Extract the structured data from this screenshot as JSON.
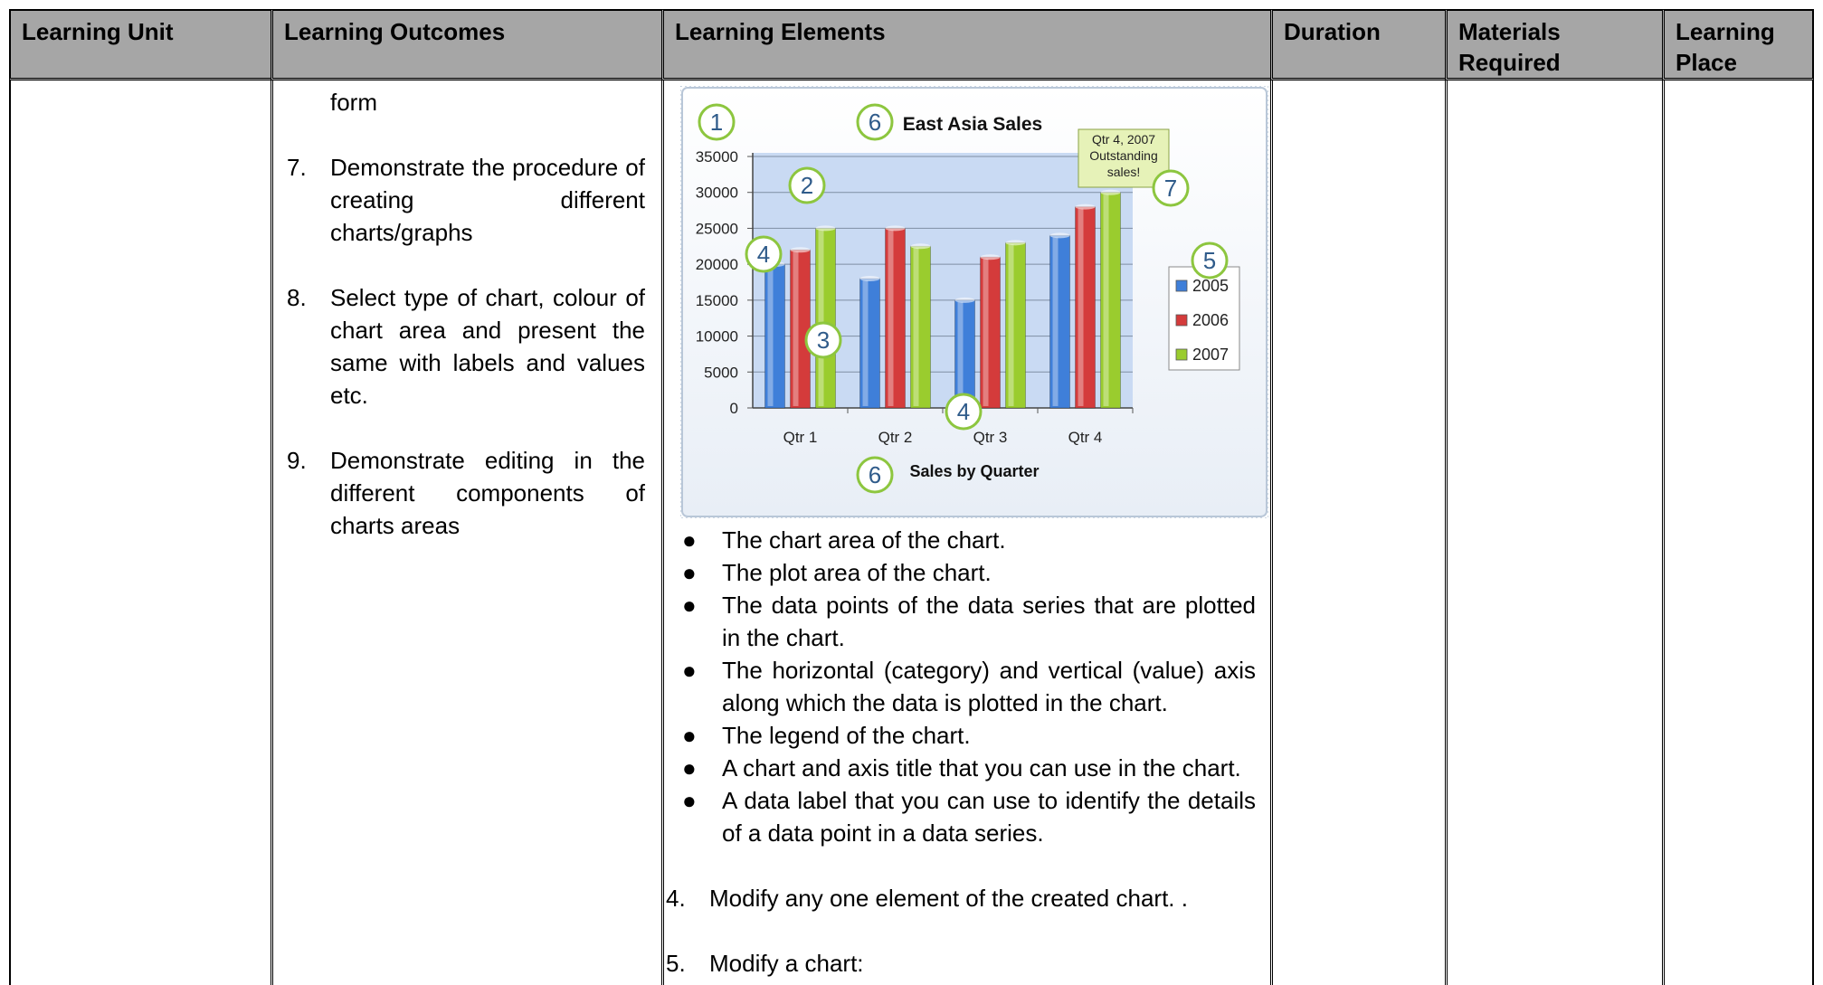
{
  "table": {
    "headers": [
      "Learning Unit",
      "Learning Outcomes",
      "Learning Elements",
      "Duration",
      "Materials Required",
      "Learning Place"
    ]
  },
  "outcomes": {
    "continued_text": "form",
    "items": [
      {
        "num": "7.",
        "text": "Demonstrate the procedure of creating different charts/graphs"
      },
      {
        "num": "8.",
        "text": "Select type of chart, colour of chart area and   present the same with labels and values etc."
      },
      {
        "num": "9.",
        "text": "Demonstrate editing in the different components of charts areas"
      }
    ]
  },
  "elements": {
    "bullets": [
      "The chart area of the chart.",
      "The plot area of the chart.",
      "The data points of the data series that are plotted in the chart.",
      "The horizontal (category) and vertical (value) axis along which the data is plotted in the chart.",
      "The legend of the chart.",
      "A chart and axis title that you can use in the chart.",
      "A data label that you can use to identify the details of a data point in a data series."
    ],
    "numbered": [
      {
        "num": "4.",
        "text": "Modify any one element of the created chart. ."
      },
      {
        "num": "5.",
        "text": "Modify a chart:"
      }
    ]
  },
  "chart_data": {
    "type": "bar",
    "title": "East Asia Sales",
    "xlabel": "Sales by Quarter",
    "ylabel": "",
    "categories": [
      "Qtr 1",
      "Qtr 2",
      "Qtr 3",
      "Qtr 4"
    ],
    "ylim": [
      0,
      35000
    ],
    "yticks": [
      "35000",
      "30000",
      "25000",
      "20000",
      "15000",
      "10000",
      "5000",
      "0"
    ],
    "series": [
      {
        "name": "2005",
        "values": [
          20000,
          18000,
          15000,
          24000
        ],
        "color": "#3f7fd9"
      },
      {
        "name": "2006",
        "values": [
          22000,
          25000,
          21000,
          28000
        ],
        "color": "#d43b3b"
      },
      {
        "name": "2007",
        "values": [
          25000,
          22500,
          23000,
          30000
        ],
        "color": "#9acc2e"
      }
    ],
    "annotation": [
      "Qtr 4, 2007",
      "Outstanding",
      "sales!"
    ],
    "callouts": [
      "1",
      "2",
      "3",
      "4",
      "4",
      "5",
      "6",
      "6",
      "7"
    ],
    "legend_position": "right",
    "grid": true
  },
  "colors": {
    "header_bg": "#a6a6a6",
    "plot_bg": "#c9daf3",
    "callout_ring": "#8dc63f",
    "annotation_bg": "#e6f2b8"
  }
}
